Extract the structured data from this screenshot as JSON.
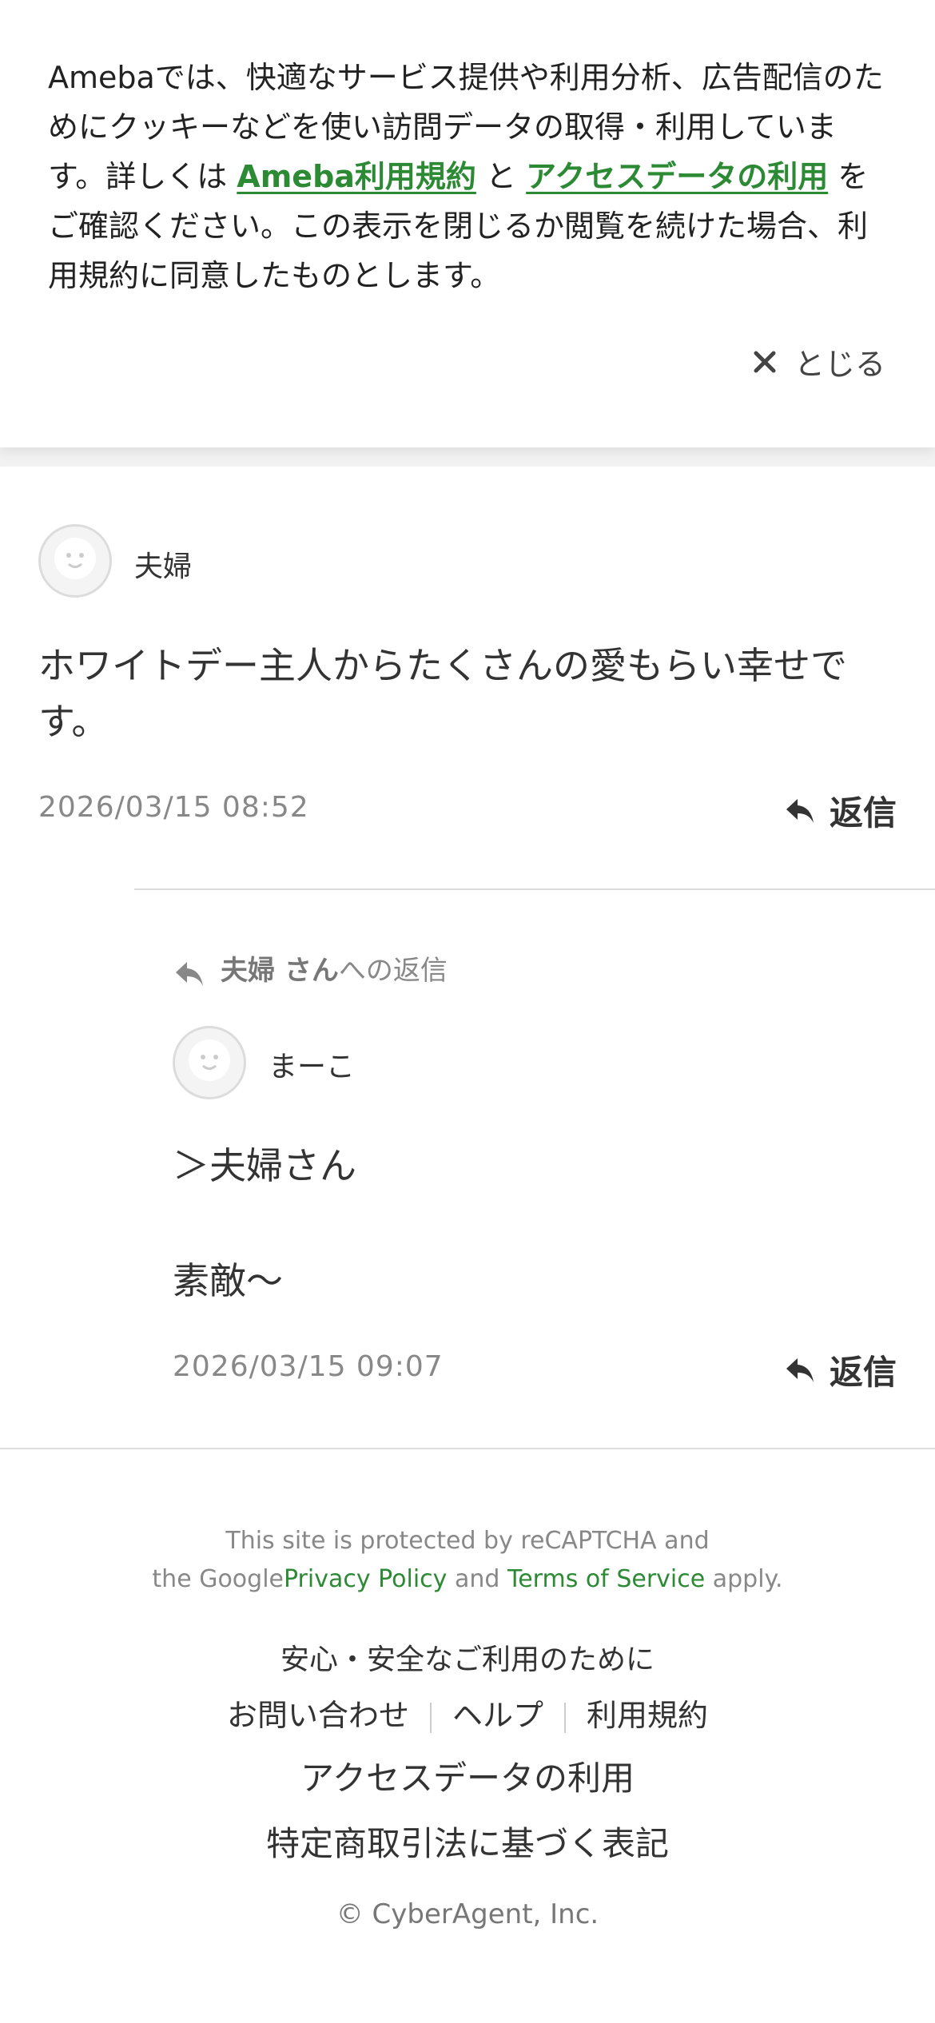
{
  "cookie_banner": {
    "text_1": "Amebaでは、快適なサービス提供や利用分析、広告配信のためにクッキーなどを使い訪問データの取得・利用しています。詳しくは",
    "link_terms": "Ameba利用規約",
    "text_and": "と",
    "link_access": "アクセスデータの利用",
    "text_2": "をご確認ください。この表示を閉じるか閲覧を続けた場合、利用規約に同意したものとします。",
    "close_label": "とじる"
  },
  "comments": [
    {
      "author": "夫婦",
      "body": "ホワイトデー主人からたくさんの愛もらい幸せです。",
      "timestamp": "2026/03/15 08:52",
      "reply_label": "返信"
    }
  ],
  "reply": {
    "reply_to_name": "夫婦 さん",
    "reply_to_suffix": "への返信",
    "author": "まーこ",
    "body_line1": "＞夫婦さん",
    "body_line2": "素敵～",
    "timestamp": "2026/03/15 09:07",
    "reply_label": "返信"
  },
  "footer": {
    "recaptcha_line1": "This site is protected by reCAPTCHA and",
    "recaptcha_prefix": "the Google",
    "privacy_policy": "Privacy Policy",
    "and": "and",
    "terms_of_service": "Terms of Service",
    "apply": "apply.",
    "safety": "安心・安全なご利用のために",
    "contact": "お問い合わせ",
    "help": "ヘルプ",
    "terms": "利用規約",
    "access_data": "アクセスデータの利用",
    "tokushoho": "特定商取引法に基づく表記",
    "copyright": "© CyberAgent, Inc."
  },
  "colors": {
    "link_green": "#2d8a34",
    "text": "#333333",
    "muted": "#888888"
  }
}
